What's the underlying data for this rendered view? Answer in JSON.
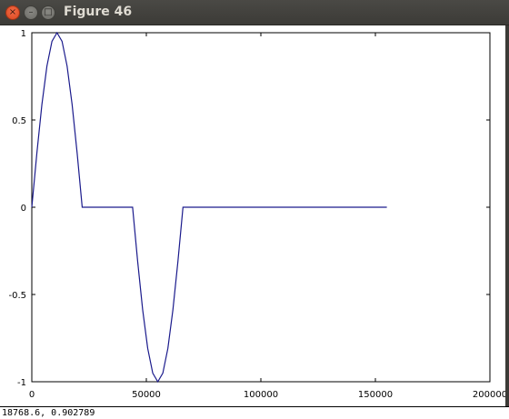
{
  "window": {
    "title": "Figure 46",
    "buttons": {
      "close_icon": "close-icon",
      "minimize_icon": "minimize-icon",
      "maximize_icon": "maximize-icon"
    }
  },
  "status": {
    "coords": "18768.6,  0.902789"
  },
  "chart_data": {
    "type": "line",
    "title": "",
    "xlabel": "",
    "ylabel": "",
    "xlim": [
      0,
      200000
    ],
    "ylim": [
      -1,
      1
    ],
    "xticks": [
      0,
      50000,
      100000,
      150000,
      200000
    ],
    "xtick_labels": [
      "0",
      "50000",
      "100000",
      "150000",
      "200000"
    ],
    "yticks": [
      -1,
      -0.5,
      0,
      0.5,
      1
    ],
    "ytick_labels": [
      "-1",
      "-0.5",
      "0",
      "0.5",
      "1"
    ],
    "grid": false,
    "color": "#1a1a8c",
    "series": [
      {
        "x": [
          0,
          2200,
          4400,
          6600,
          8800,
          11000,
          13200,
          15400,
          17600,
          19800,
          22000,
          44000,
          46200,
          48400,
          50600,
          52800,
          55000,
          57200,
          59400,
          61600,
          63800,
          66000,
          155000
        ],
        "y": [
          0,
          0.309,
          0.588,
          0.809,
          0.951,
          1,
          0.951,
          0.809,
          0.588,
          0.309,
          0,
          0,
          -0.309,
          -0.588,
          -0.809,
          -0.951,
          -1,
          -0.951,
          -0.809,
          -0.588,
          -0.309,
          0,
          0
        ]
      }
    ]
  }
}
